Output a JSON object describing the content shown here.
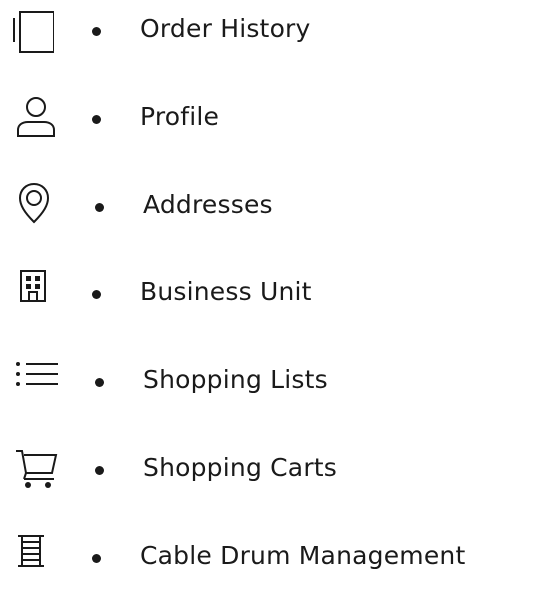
{
  "menu": {
    "items": [
      {
        "id": "order-history",
        "label": "Order History",
        "icon": "order-history-icon"
      },
      {
        "id": "profile",
        "label": "Profile",
        "icon": "user-icon"
      },
      {
        "id": "addresses",
        "label": "Addresses",
        "icon": "location-pin-icon"
      },
      {
        "id": "business-unit",
        "label": "Business Unit",
        "icon": "building-icon"
      },
      {
        "id": "shopping-lists",
        "label": "Shopping Lists",
        "icon": "list-icon"
      },
      {
        "id": "shopping-carts",
        "label": "Shopping Carts",
        "icon": "cart-icon"
      },
      {
        "id": "cable-drum-management",
        "label": "Cable Drum Management",
        "icon": "cable-drum-icon"
      }
    ]
  },
  "colors": {
    "text": "#1a1a1a",
    "background": "#ffffff"
  }
}
